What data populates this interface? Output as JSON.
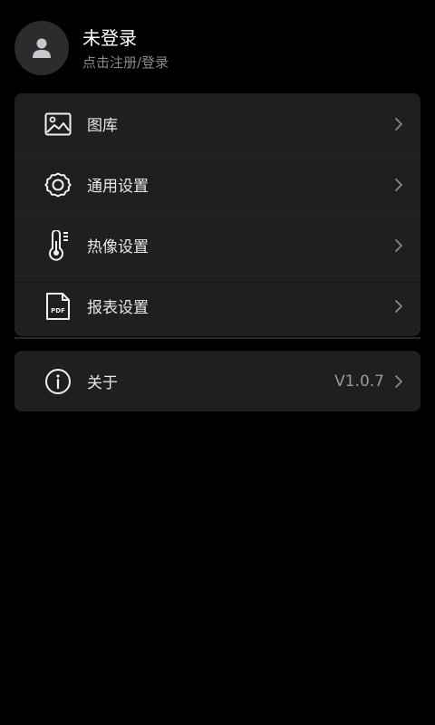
{
  "profile": {
    "name": "未登录",
    "subtitle": "点击注册/登录",
    "avatar_icon": "user-icon"
  },
  "menu": {
    "items": [
      {
        "label": "图库",
        "icon": "image-icon"
      },
      {
        "label": "通用设置",
        "icon": "gear-icon"
      },
      {
        "label": "热像设置",
        "icon": "thermometer-icon"
      },
      {
        "label": "报表设置",
        "icon": "pdf-icon"
      }
    ]
  },
  "about": {
    "label": "关于",
    "icon": "info-icon",
    "version": "V1.0.7"
  },
  "colors": {
    "background": "#000000",
    "card": "#1f1f21",
    "avatar_bg": "#2c2c2e",
    "secondary_text": "#8a8a8e"
  },
  "icons": {
    "pdf_badge": "PDF"
  }
}
